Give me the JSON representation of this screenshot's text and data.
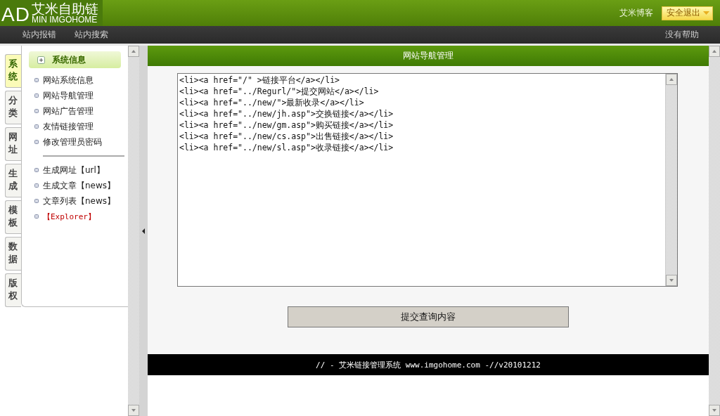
{
  "header": {
    "logo_initials": "AD",
    "logo_title": "艾米自助链",
    "logo_subtitle": "MIN IMGOHOME",
    "user": "艾米博客",
    "logout": "安全退出"
  },
  "nav": {
    "items": [
      "站内报错",
      "站内搜索"
    ],
    "help": "没有帮助"
  },
  "side_tabs": [
    {
      "label": "系统",
      "selected": true
    },
    {
      "label": "分类",
      "selected": false
    },
    {
      "label": "网址",
      "selected": false
    },
    {
      "label": "生成",
      "selected": false
    },
    {
      "label": "模板",
      "selected": false
    },
    {
      "label": "数据",
      "selected": false
    },
    {
      "label": "版权",
      "selected": false
    }
  ],
  "sidebar": {
    "heading": "系统信息",
    "groups": [
      [
        {
          "label": "网站系统信息",
          "kind": "normal"
        },
        {
          "label": "网站导航管理",
          "kind": "normal"
        },
        {
          "label": "网站广告管理",
          "kind": "normal"
        },
        {
          "label": "友情链接管理",
          "kind": "normal"
        },
        {
          "label": "修改管理员密码",
          "kind": "normal"
        }
      ],
      [
        {
          "label": "生成网址【url】",
          "kind": "normal"
        },
        {
          "label": "生成文章【news】",
          "kind": "normal"
        },
        {
          "label": "文章列表【news】",
          "kind": "normal"
        },
        {
          "label": "【Explorer】",
          "kind": "highlight"
        }
      ]
    ]
  },
  "main": {
    "title": "网站导航管理",
    "editor_lines": [
      "<li><a href=\"/\" >链接平台</a></li>",
      "<li><a href=\"../Regurl/\">提交网站</a></li>",
      "<li><a href=\"../new/\">最新收录</a></li>",
      "<li><a href=\"../new/jh.asp\">交换链接</a></li>",
      "<li><a href=\"../new/gm.asp\">购买链接</a></li>",
      "<li><a href=\"../new/cs.asp\">出售链接</a></li>",
      "<li><a href=\"../new/sl.asp\">收录链接</a></li>"
    ],
    "submit": "提交查询内容",
    "footer": "// - 艾米链接管理系统 www.imgohome.com -//v20101212"
  }
}
